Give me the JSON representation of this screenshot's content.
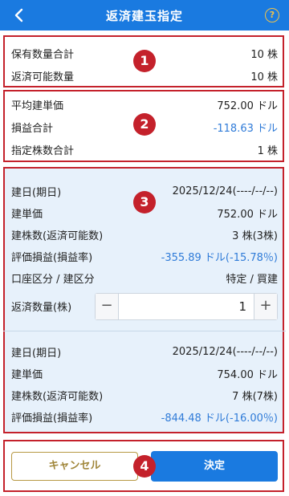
{
  "header": {
    "title": "返済建玉指定",
    "help_icon_text": "?"
  },
  "summary1": {
    "holding_total_label": "保有数量合計",
    "holding_total_value": "10 株",
    "repayable_label": "返済可能数量",
    "repayable_value": "10 株"
  },
  "summary2": {
    "avg_price_label": "平均建単価",
    "avg_price_value": "752.00 ドル",
    "pl_total_label": "損益合計",
    "pl_total_value": "-118.63 ドル",
    "designated_total_label": "指定株数合計",
    "designated_total_value": "1 株"
  },
  "positions": [
    {
      "open_date_label": "建日(期日)",
      "open_date_value": "2025/12/24(----/--/--)",
      "price_label": "建単価",
      "price_value": "752.00 ドル",
      "shares_label": "建株数(返済可能数)",
      "shares_value": "3 株(3株)",
      "eval_label": "評価損益(損益率)",
      "eval_value": "-355.89 ドル(-15.78％)",
      "account_label": "口座区分 / 建区分",
      "account_value": "特定 / 買建",
      "qty_label": "返済数量(株)",
      "qty_value": "1"
    },
    {
      "open_date_label": "建日(期日)",
      "open_date_value": "2025/12/24(----/--/--)",
      "price_label": "建単価",
      "price_value": "754.00 ドル",
      "shares_label": "建株数(返済可能数)",
      "shares_value": "7 株(7株)",
      "eval_label": "評価損益(損益率)",
      "eval_value": "-844.48 ドル(-16.00％)"
    }
  ],
  "buttons": {
    "cancel": "キャンセル",
    "confirm": "決定"
  },
  "stepper": {
    "minus": "−",
    "plus": "+"
  },
  "markers": [
    "1",
    "2",
    "3",
    "4"
  ],
  "colors": {
    "accent": "#1a7ae0",
    "negative": "#2f7bd8",
    "highlight_border": "#c4212b"
  }
}
